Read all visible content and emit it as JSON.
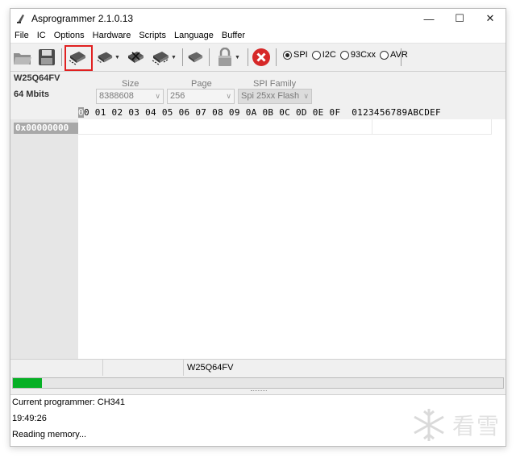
{
  "window": {
    "title": "Asprogrammer 2.1.0.13",
    "minimize": "—",
    "maximize": "☐",
    "close": "✕"
  },
  "menu": [
    "File",
    "IC",
    "Options",
    "Hardware",
    "Scripts",
    "Language",
    "Buffer"
  ],
  "toolbar": {
    "icons": [
      "open-file-icon",
      "save-icon",
      "read-chip-icon",
      "write-chip-icon",
      "erase-chip-icon",
      "verify-chip-icon",
      "chip-id-icon",
      "lock-icon",
      "stop-icon"
    ],
    "protocols": [
      "SPI",
      "I2C",
      "93Cxx",
      "AVR"
    ],
    "selected_protocol": "SPI"
  },
  "chip": {
    "name": "W25Q64FV",
    "capacity": "64 Mbits"
  },
  "selectors": {
    "size_label": "Size",
    "size_value": "8388608",
    "page_label": "Page",
    "page_value": "256",
    "family_label": "SPI Family",
    "family_value": "Spi 25xx Flash"
  },
  "hex": {
    "cursor_col": "0",
    "header_rest": "0 01 02 03 04 05 06 07 08 09 0A 0B 0C 0D 0E 0F  0123456789ABCDEF",
    "first_address": "0x00000000"
  },
  "status": {
    "chip_name": "W25Q64FV"
  },
  "progress": {
    "percent": 6
  },
  "log": [
    "Current programmer: CH341",
    "19:49:26",
    "Reading memory..."
  ],
  "watermark": {
    "text": "看雪"
  },
  "colors": {
    "progress": "#06b025",
    "highlight": "#e02020",
    "stop": "#d62828"
  }
}
